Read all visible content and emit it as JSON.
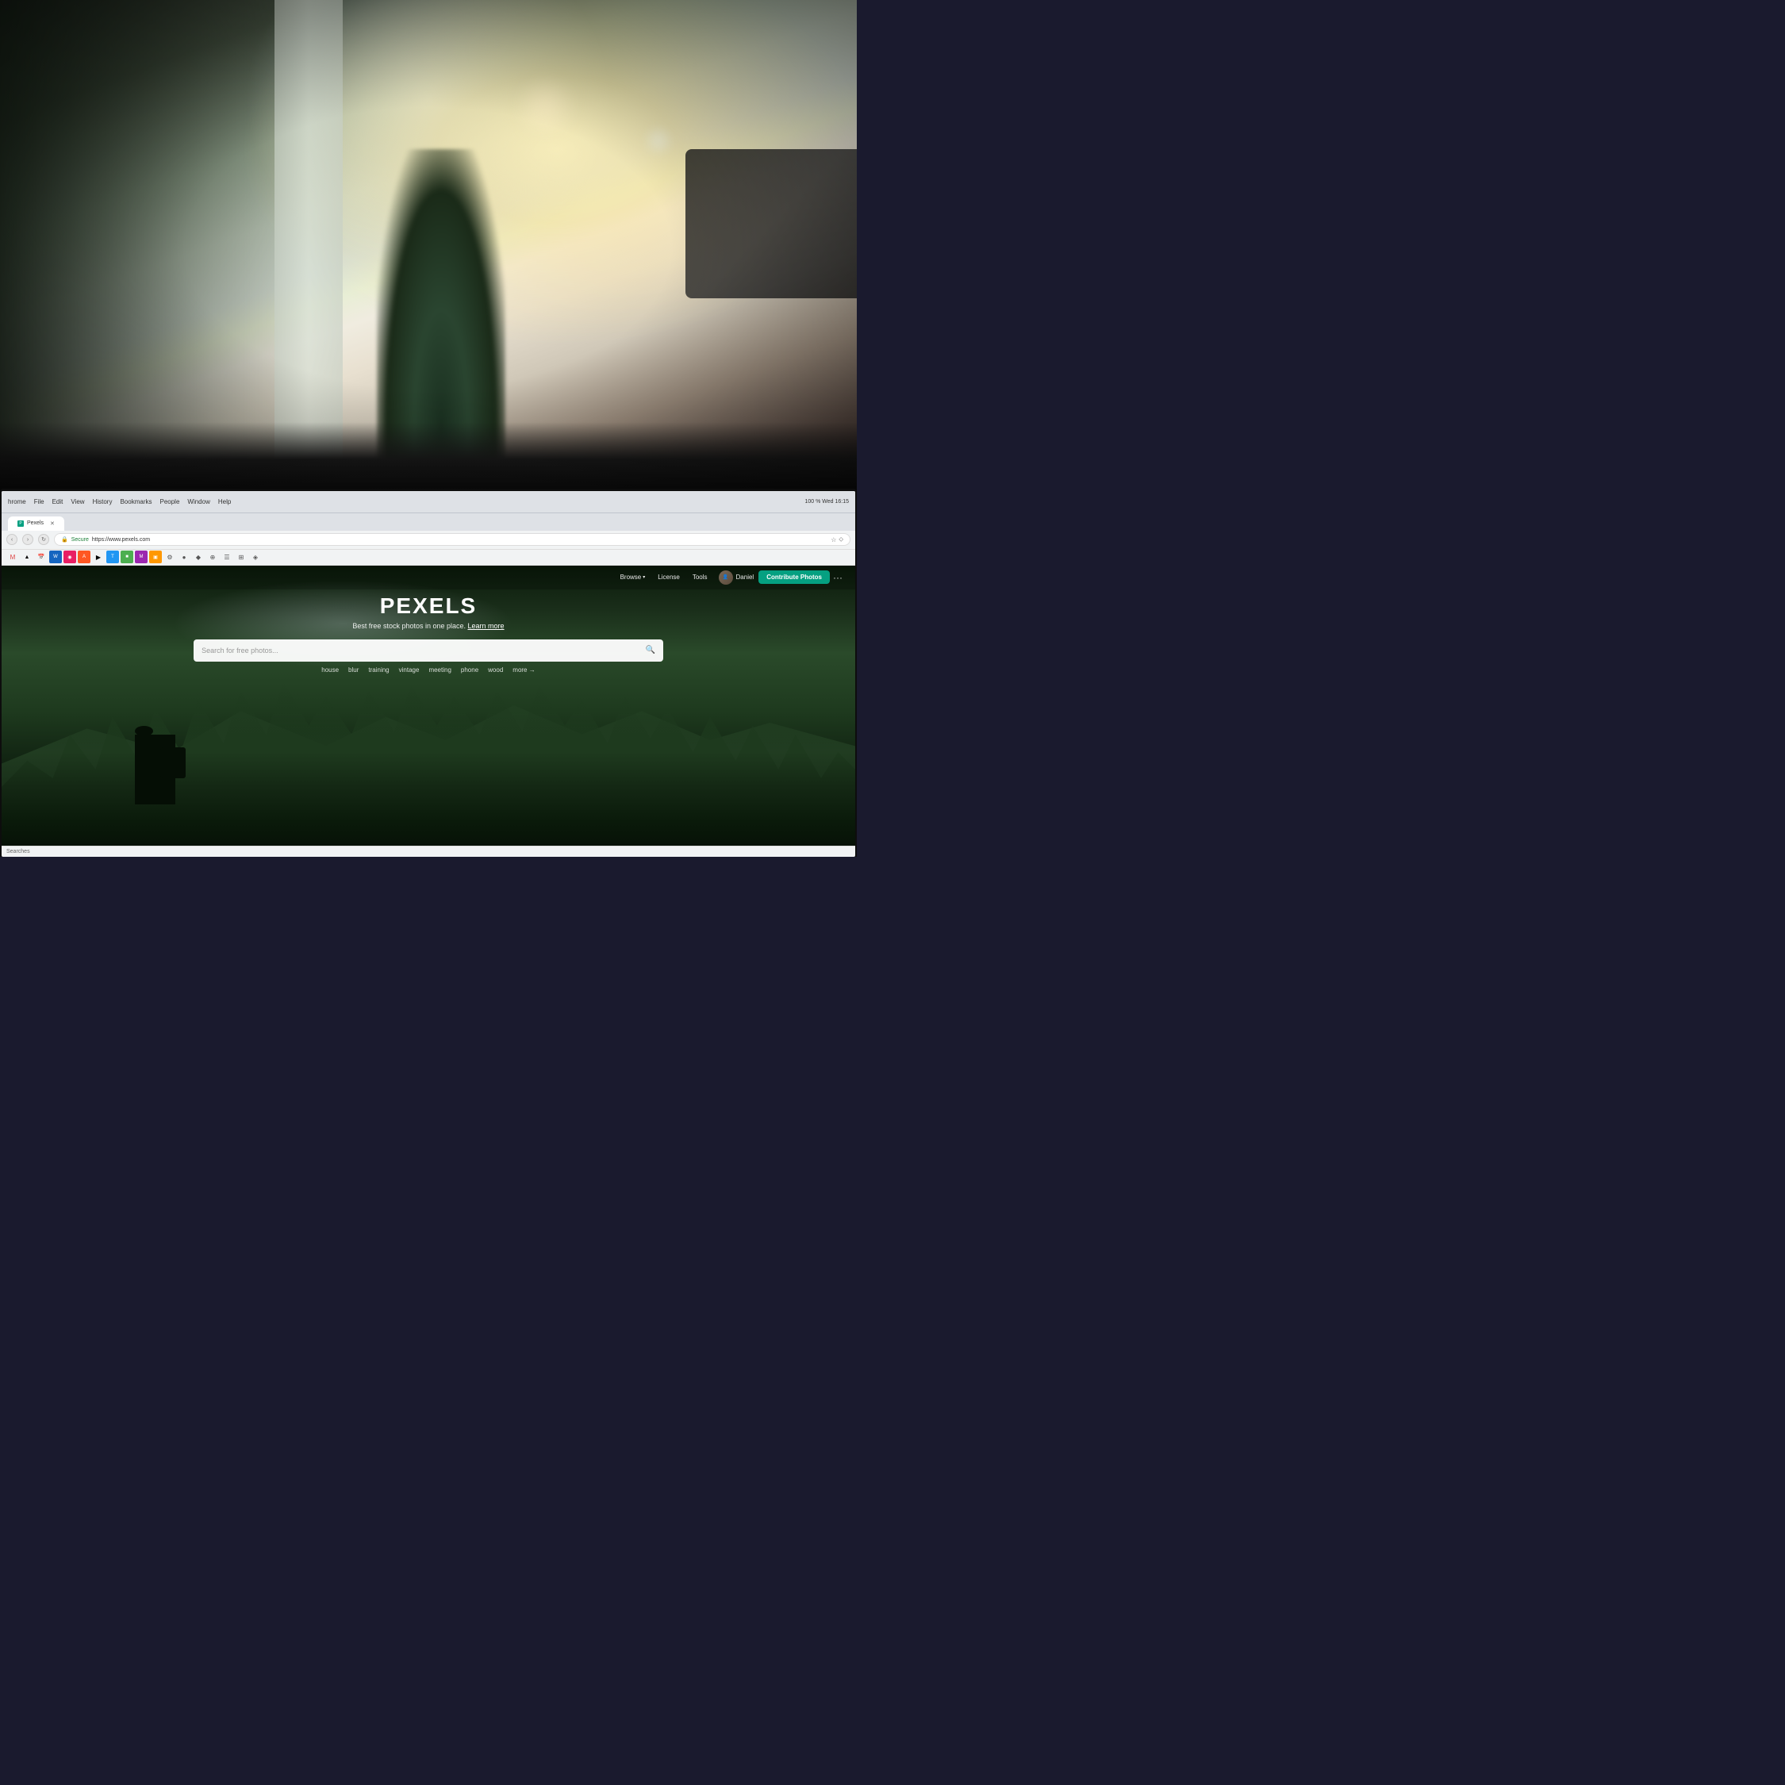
{
  "photo_background": {
    "description": "Office/workspace background photo with bokeh lighting"
  },
  "chrome": {
    "menu_items": [
      "hrome",
      "File",
      "Edit",
      "View",
      "History",
      "Bookmarks",
      "People",
      "Window",
      "Help"
    ],
    "system_info": "100 %  Wed 16:15",
    "url": "https://www.pexels.com",
    "secure_label": "Secure",
    "tab_label": "Pexels"
  },
  "pexels": {
    "nav": {
      "browse_label": "Browse",
      "license_label": "License",
      "tools_label": "Tools",
      "user_name": "Daniel",
      "contribute_label": "Contribute Photos",
      "more_label": "···"
    },
    "hero": {
      "logo": "PEXELS",
      "tagline": "Best free stock photos in one place.",
      "learn_more": "Learn more",
      "search_placeholder": "Search for free photos..."
    },
    "search_tags": [
      "house",
      "blur",
      "training",
      "vintage",
      "meeting",
      "phone",
      "wood",
      "more →"
    ]
  },
  "status_bar": {
    "text": "Searches"
  }
}
